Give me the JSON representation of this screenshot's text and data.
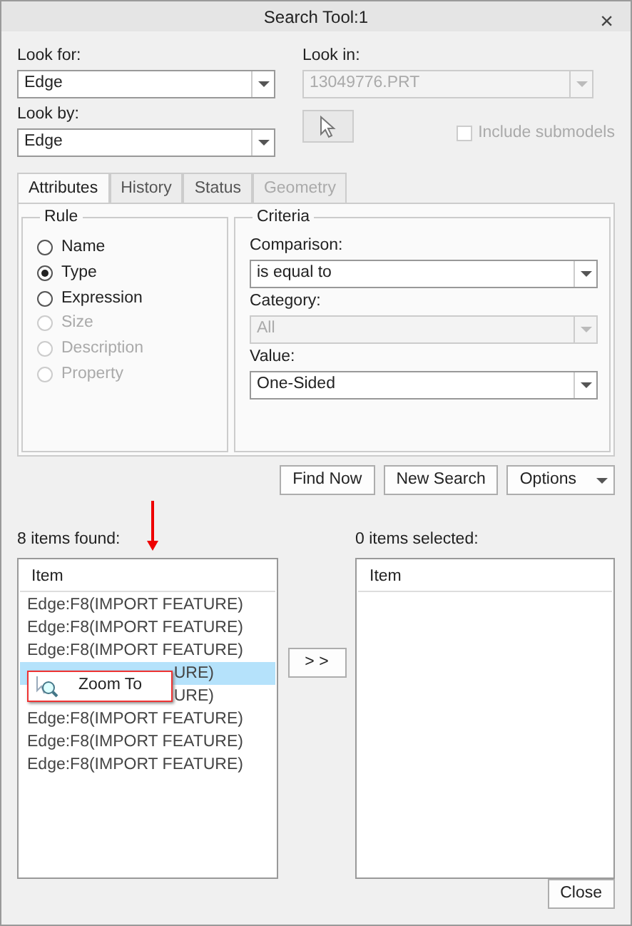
{
  "window": {
    "title": "Search Tool:1",
    "close": "×"
  },
  "look_for": {
    "label": "Look for:",
    "value": "Edge",
    "disabled": false
  },
  "look_by": {
    "label": "Look by:",
    "value": "Edge",
    "disabled": false
  },
  "look_in": {
    "label": "Look in:",
    "value": "13049776.PRT",
    "disabled": true
  },
  "include_submodels": {
    "label": "Include submodels",
    "checked": false,
    "disabled": true
  },
  "tabs": [
    {
      "label": "Attributes",
      "selected": true,
      "disabled": false
    },
    {
      "label": "History",
      "selected": false,
      "disabled": false
    },
    {
      "label": "Status",
      "selected": false,
      "disabled": false
    },
    {
      "label": "Geometry",
      "selected": false,
      "disabled": true
    }
  ],
  "rule": {
    "title": "Rule",
    "options": [
      {
        "label": "Name",
        "selected": false,
        "disabled": false
      },
      {
        "label": "Type",
        "selected": true,
        "disabled": false
      },
      {
        "label": "Expression",
        "selected": false,
        "disabled": false
      },
      {
        "label": "Size",
        "selected": false,
        "disabled": true
      },
      {
        "label": "Description",
        "selected": false,
        "disabled": true
      },
      {
        "label": "Property",
        "selected": false,
        "disabled": true
      }
    ]
  },
  "criteria": {
    "title": "Criteria",
    "fields": [
      {
        "label": "Comparison:",
        "value": "is equal to",
        "disabled": false
      },
      {
        "label": "Category:",
        "value": "All",
        "disabled": true
      },
      {
        "label": "Value:",
        "value": "One-Sided",
        "disabled": false
      }
    ]
  },
  "actions": [
    {
      "label": "Find Now",
      "kind": "plain"
    },
    {
      "label": "New Search",
      "kind": "plain"
    },
    {
      "label": "Options",
      "kind": "dropdown"
    }
  ],
  "found": {
    "label": "8 items found:",
    "column": "Item",
    "rows": [
      {
        "text": "Edge:F8(IMPORT FEATURE)",
        "selected": false,
        "kind": "full"
      },
      {
        "text": "Edge:F8(IMPORT FEATURE)",
        "selected": false,
        "kind": "full"
      },
      {
        "text": "Edge:F8(IMPORT FEATURE)",
        "selected": false,
        "kind": "full"
      },
      {
        "text": "URE)",
        "selected": true,
        "kind": "partial"
      },
      {
        "text": "URE)",
        "selected": false,
        "kind": "partial"
      },
      {
        "text": "Edge:F8(IMPORT FEATURE)",
        "selected": false,
        "kind": "full"
      },
      {
        "text": "Edge:F8(IMPORT FEATURE)",
        "selected": false,
        "kind": "full"
      },
      {
        "text": "Edge:F8(IMPORT FEATURE)",
        "selected": false,
        "kind": "full"
      }
    ]
  },
  "move_button": "> >",
  "selected_list": {
    "label": "0 items selected:",
    "column": "Item"
  },
  "context_menu": {
    "items": [
      {
        "label": "Zoom To"
      }
    ]
  },
  "close_button": "Close"
}
